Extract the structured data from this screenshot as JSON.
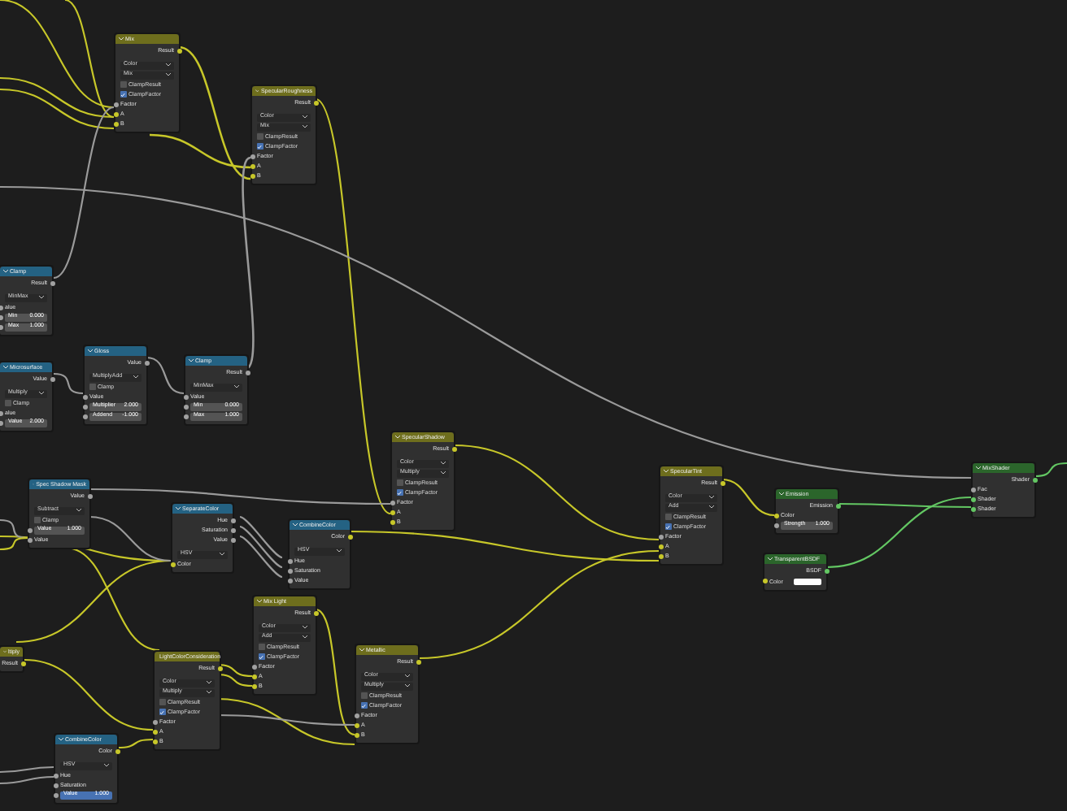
{
  "nodes": [
    {
      "title": "Mix",
      "kind": "mix",
      "rows": [
        {
          "kind": "output",
          "label": "Result",
          "color": "#c7c729"
        },
        {
          "kind": "dropdown",
          "value": "Color"
        },
        {
          "kind": "dropdown",
          "value": "Mix"
        },
        {
          "kind": "checkbox",
          "label": "ClampResult",
          "checked": false
        },
        {
          "kind": "checkbox",
          "label": "ClampFactor",
          "checked": true
        },
        {
          "kind": "input",
          "label": "Factor",
          "color": "#a1a1a1"
        },
        {
          "kind": "input",
          "label": "A",
          "color": "#c7c729"
        },
        {
          "kind": "input",
          "label": "B",
          "color": "#c7c729"
        }
      ]
    },
    {
      "title": "SpecularRoughness",
      "kind": "mix",
      "rows": [
        {
          "kind": "output",
          "label": "Result",
          "color": "#c7c729"
        },
        {
          "kind": "dropdown",
          "value": "Color"
        },
        {
          "kind": "dropdown",
          "value": "Mix"
        },
        {
          "kind": "checkbox",
          "label": "ClampResult",
          "checked": false
        },
        {
          "kind": "checkbox",
          "label": "ClampFactor",
          "checked": true
        },
        {
          "kind": "input",
          "label": "Factor",
          "color": "#a1a1a1"
        },
        {
          "kind": "input",
          "label": "A",
          "color": "#c7c729"
        },
        {
          "kind": "input",
          "label": "B",
          "color": "#c7c729"
        }
      ]
    },
    {
      "title": "Clamp",
      "kind": "converter",
      "rows": [
        {
          "kind": "output",
          "label": "Result",
          "color": "#a1a1a1"
        },
        {
          "kind": "dropdown",
          "value": "MinMax"
        },
        {
          "kind": "input",
          "label": "alue",
          "color": "#a1a1a1"
        },
        {
          "kind": "field",
          "label": "Min",
          "value": "0.000",
          "selected": false,
          "color": "#a1a1a1"
        },
        {
          "kind": "field",
          "label": "Max",
          "value": "1.000",
          "selected": false,
          "color": "#a1a1a1"
        }
      ]
    },
    {
      "title": "Microsurface",
      "kind": "converter",
      "rows": [
        {
          "kind": "output",
          "label": "Value",
          "color": "#a1a1a1"
        },
        {
          "kind": "dropdown",
          "value": "Multiply"
        },
        {
          "kind": "checkbox",
          "label": "Clamp",
          "checked": false
        },
        {
          "kind": "input",
          "label": "alue",
          "color": "#a1a1a1"
        },
        {
          "kind": "field",
          "label": "Value",
          "value": "2.000",
          "selected": false,
          "color": "#a1a1a1"
        }
      ]
    },
    {
      "title": "Gloss",
      "kind": "converter",
      "rows": [
        {
          "kind": "output",
          "label": "Value",
          "color": "#a1a1a1"
        },
        {
          "kind": "dropdown",
          "value": "MultiplyAdd"
        },
        {
          "kind": "checkbox",
          "label": "Clamp",
          "checked": false
        },
        {
          "kind": "input",
          "label": "Value",
          "color": "#a1a1a1"
        },
        {
          "kind": "field",
          "label": "Multiplier",
          "value": "2.000",
          "selected": false,
          "color": "#a1a1a1"
        },
        {
          "kind": "field",
          "label": "Addend",
          "value": "-1.000",
          "selected": false,
          "color": "#a1a1a1"
        }
      ]
    },
    {
      "title": "Clamp",
      "kind": "converter",
      "rows": [
        {
          "kind": "output",
          "label": "Result",
          "color": "#a1a1a1"
        },
        {
          "kind": "dropdown",
          "value": "MinMax"
        },
        {
          "kind": "input",
          "label": "Value",
          "color": "#a1a1a1"
        },
        {
          "kind": "field",
          "label": "Min",
          "value": "0.000",
          "selected": false,
          "color": "#a1a1a1"
        },
        {
          "kind": "field",
          "label": "Max",
          "value": "1.000",
          "selected": false,
          "color": "#a1a1a1"
        }
      ]
    },
    {
      "title": "Spec Shadow Mask",
      "kind": "converter",
      "rows": [
        {
          "kind": "output",
          "label": "Value",
          "color": "#a1a1a1"
        },
        {
          "kind": "dropdown",
          "value": "Subtract"
        },
        {
          "kind": "checkbox",
          "label": "Clamp",
          "checked": false
        },
        {
          "kind": "field",
          "label": "Value",
          "value": "1.000",
          "selected": false,
          "color": "#a1a1a1"
        },
        {
          "kind": "input",
          "label": "Value",
          "color": "#a1a1a1"
        }
      ]
    },
    {
      "title": "SeparateColor",
      "kind": "converter",
      "rows": [
        {
          "kind": "output",
          "label": "Hue",
          "color": "#a1a1a1"
        },
        {
          "kind": "output",
          "label": "Saturation",
          "color": "#a1a1a1"
        },
        {
          "kind": "output",
          "label": "Value",
          "color": "#a1a1a1"
        },
        {
          "kind": "dropdown",
          "value": "HSV"
        },
        {
          "kind": "input",
          "label": "Color",
          "color": "#c7c729"
        }
      ]
    },
    {
      "title": "CombineColor",
      "kind": "converter",
      "rows": [
        {
          "kind": "output",
          "label": "Color",
          "color": "#c7c729"
        },
        {
          "kind": "dropdown",
          "value": "HSV"
        },
        {
          "kind": "input",
          "label": "Hue",
          "color": "#a1a1a1"
        },
        {
          "kind": "input",
          "label": "Saturation",
          "color": "#a1a1a1"
        },
        {
          "kind": "input",
          "label": "Value",
          "color": "#a1a1a1"
        }
      ]
    },
    {
      "title": "SpecularShadow",
      "kind": "mix",
      "rows": [
        {
          "kind": "output",
          "label": "Result",
          "color": "#c7c729"
        },
        {
          "kind": "dropdown",
          "value": "Color"
        },
        {
          "kind": "dropdown",
          "value": "Multiply"
        },
        {
          "kind": "checkbox",
          "label": "ClampResult",
          "checked": false
        },
        {
          "kind": "checkbox",
          "label": "ClampFactor",
          "checked": true
        },
        {
          "kind": "input",
          "label": "Factor",
          "color": "#a1a1a1"
        },
        {
          "kind": "input",
          "label": "A",
          "color": "#c7c729"
        },
        {
          "kind": "input",
          "label": "B",
          "color": "#c7c729"
        }
      ]
    },
    {
      "title": "ltiply",
      "kind": "mix",
      "rows": [
        {
          "kind": "output",
          "label": "Result",
          "color": "#c7c729"
        }
      ]
    },
    {
      "title": "LightColorConsideration",
      "kind": "mix",
      "rows": [
        {
          "kind": "output",
          "label": "Result",
          "color": "#c7c729"
        },
        {
          "kind": "dropdown",
          "value": "Color"
        },
        {
          "kind": "dropdown",
          "value": "Multiply"
        },
        {
          "kind": "checkbox",
          "label": "ClampResult",
          "checked": false
        },
        {
          "kind": "checkbox",
          "label": "ClampFactor",
          "checked": true
        },
        {
          "kind": "input",
          "label": "Factor",
          "color": "#a1a1a1"
        },
        {
          "kind": "input",
          "label": "A",
          "color": "#c7c729"
        },
        {
          "kind": "input",
          "label": "B",
          "color": "#c7c729"
        }
      ]
    },
    {
      "title": "Mix Light",
      "kind": "mix",
      "rows": [
        {
          "kind": "output",
          "label": "Result",
          "color": "#c7c729"
        },
        {
          "kind": "dropdown",
          "value": "Color"
        },
        {
          "kind": "dropdown",
          "value": "Add"
        },
        {
          "kind": "checkbox",
          "label": "ClampResult",
          "checked": false
        },
        {
          "kind": "checkbox",
          "label": "ClampFactor",
          "checked": true
        },
        {
          "kind": "input",
          "label": "Factor",
          "color": "#a1a1a1"
        },
        {
          "kind": "input",
          "label": "A",
          "color": "#c7c729"
        },
        {
          "kind": "input",
          "label": "B",
          "color": "#c7c729"
        }
      ]
    },
    {
      "title": "Metallic",
      "kind": "mix",
      "rows": [
        {
          "kind": "output",
          "label": "Result",
          "color": "#c7c729"
        },
        {
          "kind": "dropdown",
          "value": "Color"
        },
        {
          "kind": "dropdown",
          "value": "Multiply"
        },
        {
          "kind": "checkbox",
          "label": "ClampResult",
          "checked": false
        },
        {
          "kind": "checkbox",
          "label": "ClampFactor",
          "checked": true
        },
        {
          "kind": "input",
          "label": "Factor",
          "color": "#a1a1a1"
        },
        {
          "kind": "input",
          "label": "A",
          "color": "#c7c729"
        },
        {
          "kind": "input",
          "label": "B",
          "color": "#c7c729"
        }
      ]
    },
    {
      "title": "CombineColor",
      "kind": "converter",
      "rows": [
        {
          "kind": "output",
          "label": "Color",
          "color": "#c7c729"
        },
        {
          "kind": "dropdown",
          "value": "HSV"
        },
        {
          "kind": "input",
          "label": "Hue",
          "color": "#a1a1a1"
        },
        {
          "kind": "input",
          "label": "Saturation",
          "color": "#a1a1a1"
        },
        {
          "kind": "field",
          "label": "Value",
          "value": "1.000",
          "selected": true,
          "color": "#a1a1a1"
        }
      ]
    },
    {
      "title": "SpecularTint",
      "kind": "mix",
      "rows": [
        {
          "kind": "output",
          "label": "Result",
          "color": "#c7c729"
        },
        {
          "kind": "dropdown",
          "value": "Color"
        },
        {
          "kind": "dropdown",
          "value": "Add"
        },
        {
          "kind": "checkbox",
          "label": "ClampResult",
          "checked": false
        },
        {
          "kind": "checkbox",
          "label": "ClampFactor",
          "checked": true
        },
        {
          "kind": "input",
          "label": "Factor",
          "color": "#a1a1a1"
        },
        {
          "kind": "input",
          "label": "A",
          "color": "#c7c729"
        },
        {
          "kind": "input",
          "label": "B",
          "color": "#c7c729"
        }
      ]
    },
    {
      "title": "Emission",
      "kind": "shader",
      "rows": [
        {
          "kind": "output",
          "label": "Emission",
          "color": "#63c763"
        },
        {
          "kind": "input",
          "label": "Color",
          "color": "#c7c729"
        },
        {
          "kind": "field",
          "label": "Strength",
          "value": "1.000",
          "selected": false,
          "color": "#a1a1a1"
        }
      ]
    },
    {
      "title": "TransparentBSDF",
      "kind": "shader",
      "rows": [
        {
          "kind": "output",
          "label": "BSDF",
          "color": "#63c763"
        },
        {
          "kind": "swatch",
          "label": "Color",
          "color": "#c7c729"
        }
      ]
    },
    {
      "title": "MixShader",
      "kind": "shader",
      "rows": [
        {
          "kind": "output",
          "label": "Shader",
          "color": "#63c763"
        },
        {
          "kind": "input",
          "label": "Fac",
          "color": "#a1a1a1"
        },
        {
          "kind": "input",
          "label": "Shader",
          "color": "#63c763"
        },
        {
          "kind": "input",
          "label": "Shader",
          "color": "#63c763"
        }
      ]
    }
  ]
}
